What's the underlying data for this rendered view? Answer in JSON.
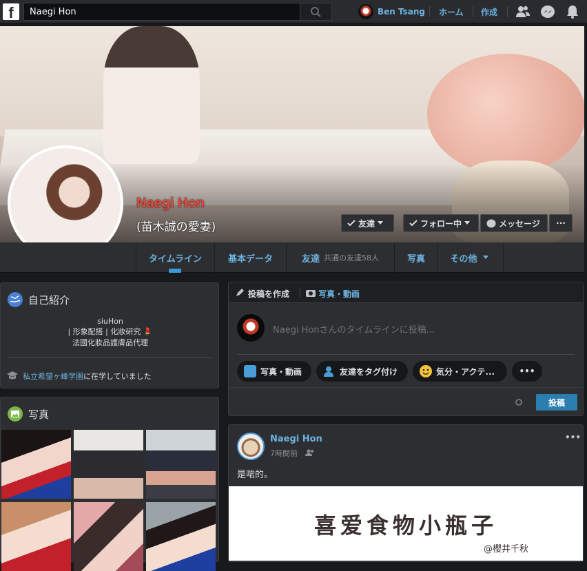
{
  "topbar": {
    "logo": "f",
    "search_value": "Naegi Hon",
    "user_name": "Ben Tsang",
    "home": "ホーム",
    "create": "作成",
    "icons": [
      "friends-icon",
      "messenger-icon",
      "notifications-icon"
    ]
  },
  "profile": {
    "name": "Naegi Hon",
    "alt_name": "(苗木誠の愛妻)",
    "friends_btn": "友達",
    "follow_btn": "フォロー中",
    "message_btn": "メッセージ",
    "more_btn": "···"
  },
  "tabs": [
    {
      "label": "タイムライン"
    },
    {
      "label": "基本データ"
    },
    {
      "label": "友達",
      "sub": "共通の友達58人"
    },
    {
      "label": "写真"
    },
    {
      "label": "その他"
    }
  ],
  "intro": {
    "title": "自己紹介",
    "line1": "siuHon",
    "line2": "| 形象配搭 | 化妝研究 💄",
    "line3": "法國化妝品護膚品代理",
    "school_link": "私立希望ヶ峰学園",
    "school_suffix": "に在学していました"
  },
  "photos": {
    "title": "写真"
  },
  "composer": {
    "tab_post": "投稿を作成",
    "tab_photo": "写真・動画",
    "placeholder": "Naegi Honさんのタイムラインに投稿...",
    "chip_photo": "写真・動画",
    "chip_tag": "友達をタグ付け",
    "chip_feeling": "気分・アクテ...",
    "chip_more": "•••",
    "post_button": "投稿"
  },
  "post": {
    "author": "Naegi Hon",
    "time": "7時間前",
    "menu": "•••",
    "text": "是啱的。",
    "image_title": "喜爱食物小瓶子",
    "image_credit": "@櫻井千秋"
  },
  "colors": {
    "accent": "#6cb2e0",
    "name_red": "#e8463a",
    "primary_button": "#2b7fb0"
  }
}
